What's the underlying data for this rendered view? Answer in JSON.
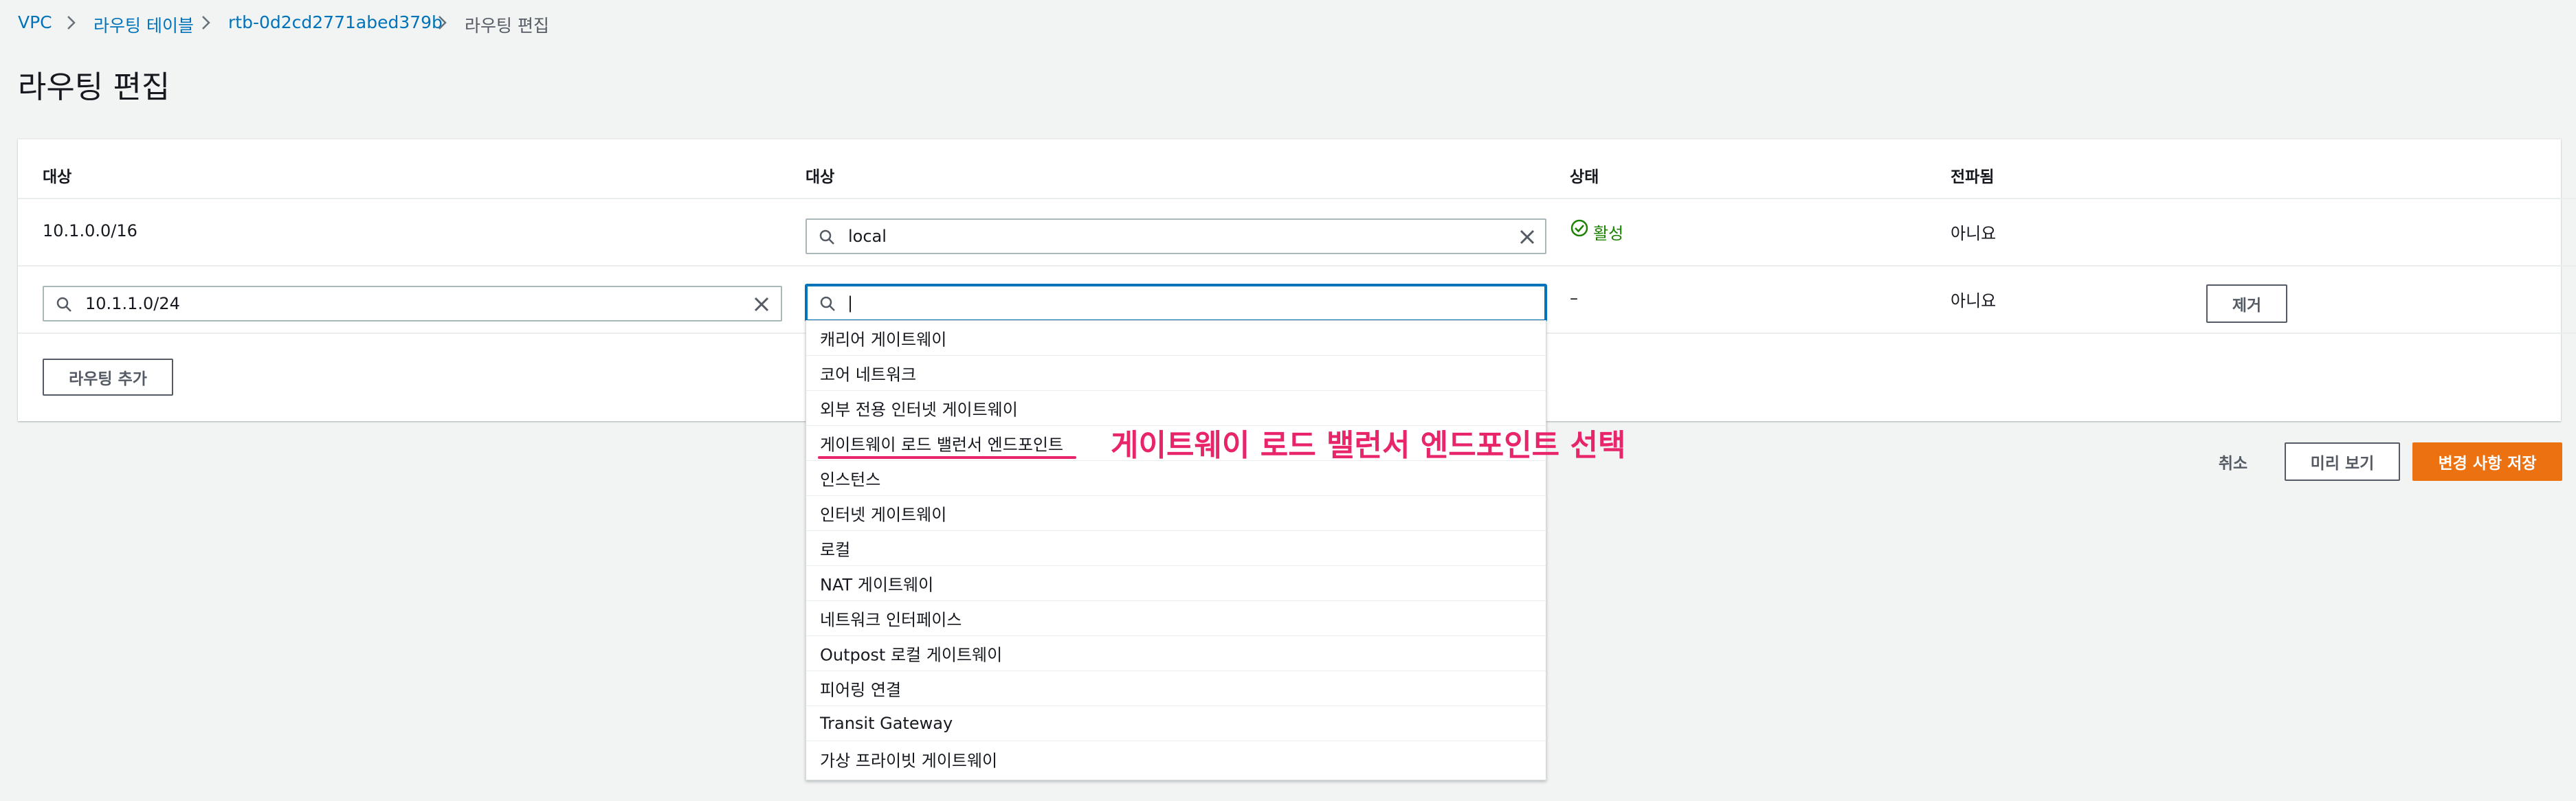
{
  "breadcrumb": {
    "items": [
      "VPC",
      "라우팅 테이블",
      "rtb-0d2cd2771abed379b",
      "라우팅 편집"
    ]
  },
  "page": {
    "title": "라우팅 편집"
  },
  "table": {
    "headers": {
      "destination": "대상",
      "target": "대상",
      "status": "상태",
      "propagated": "전파됨"
    },
    "rows": [
      {
        "destination": "10.1.0.0/16",
        "target": "local",
        "status": "활성",
        "propagated": "아니요"
      },
      {
        "destination": "10.1.1.0/24",
        "target": "|",
        "status": "–",
        "propagated": "아니요",
        "remove_label": "제거"
      }
    ],
    "add_route_label": "라우팅 추가"
  },
  "dropdown": {
    "options": [
      "캐리어 게이트웨이",
      "코어 네트워크",
      "외부 전용 인터넷 게이트웨이",
      "게이트웨이 로드 밸런서 엔드포인트",
      "인스턴스",
      "인터넷 게이트웨이",
      "로컬",
      "NAT 게이트웨이",
      "네트워크 인터페이스",
      "Outpost 로컬 게이트웨이",
      "피어링 연결",
      "Transit Gateway",
      "가상 프라이빗 게이트웨이"
    ]
  },
  "annotation": {
    "text": "게이트웨이 로드 밸런서 엔드포인트 선택",
    "color": "#e8246b"
  },
  "footer": {
    "cancel_label": "취소",
    "preview_label": "미리 보기",
    "save_label": "변경 사항 저장"
  },
  "colors": {
    "link": "#0073bb",
    "primary": "#ec7211",
    "success": "#1d8102",
    "focus": "#0073bb"
  },
  "icons": [
    "chevron-right-icon",
    "search-icon",
    "clear-icon",
    "status-check-icon"
  ]
}
